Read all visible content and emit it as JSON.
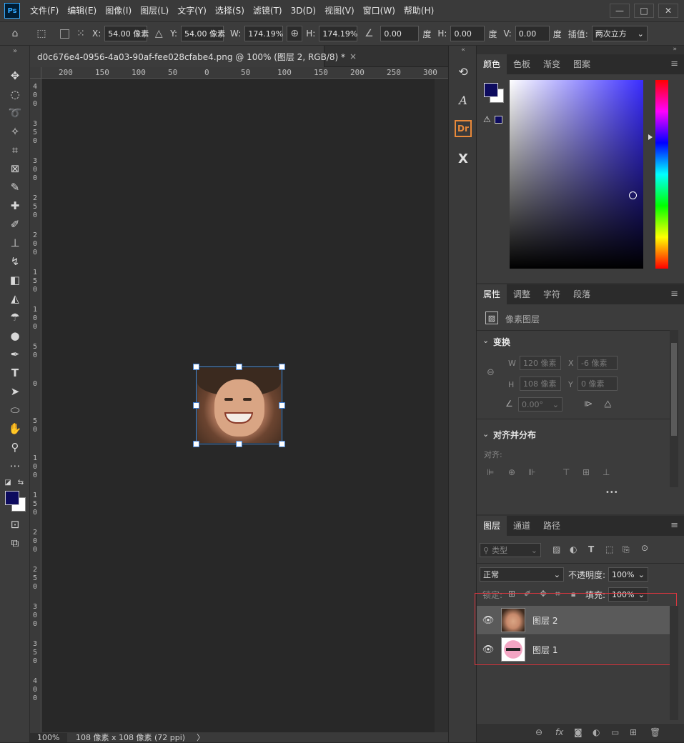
{
  "menubar": {
    "logo": "Ps",
    "items": [
      "文件(F)",
      "编辑(E)",
      "图像(I)",
      "图层(L)",
      "文字(Y)",
      "选择(S)",
      "滤镜(T)",
      "3D(D)",
      "视图(V)",
      "窗口(W)",
      "帮助(H)"
    ],
    "window_buttons": [
      "—",
      "□",
      "✕"
    ]
  },
  "options": {
    "x_label": "X:",
    "x_value": "54.00 像素",
    "y_label": "Y:",
    "y_value": "54.00 像素",
    "w_label": "W:",
    "w_value": "174.19%",
    "h_label": "H:",
    "h_value": "174.19%",
    "angle_value": "0.00",
    "angle_unit": "度",
    "hskew_label": "H:",
    "hskew_value": "0.00",
    "hskew_unit": "度",
    "vskew_label": "V:",
    "vskew_value": "0.00",
    "vskew_unit": "度",
    "interp_label": "插值:",
    "interp_value": "两次立方"
  },
  "document": {
    "tab_title": "d0c676e4-0956-4a03-90af-fee028cfabe4.png @ 100% (图层 2, RGB/8) *",
    "close": "×",
    "ruler_top": [
      "200",
      "150",
      "100",
      "50",
      "0",
      "50",
      "100",
      "150",
      "200",
      "250",
      "300"
    ],
    "ruler_left": [
      "400",
      "350",
      "300",
      "250",
      "200",
      "150",
      "100",
      "50",
      "0",
      "50",
      "100",
      "150",
      "200",
      "250",
      "300",
      "350",
      "400"
    ],
    "zoom": "100%",
    "doc_info": "108 像素 x 108 像素 (72 ppi)",
    "arrow": "〉"
  },
  "color_panel": {
    "tabs": [
      "颜色",
      "色板",
      "渐变",
      "图案"
    ],
    "foreground": "#0d0b5e",
    "background": "#ffffff",
    "hue": "#3a2dff"
  },
  "properties_panel": {
    "tabs": [
      "属性",
      "调整",
      "字符",
      "段落"
    ],
    "kind": "像素图层",
    "transform_title": "变换",
    "w_label": "W",
    "w_value": "120 像素",
    "x_label": "X",
    "x_value": "-6 像素",
    "h_label": "H",
    "h_value": "108 像素",
    "y_label": "Y",
    "y_value": "0 像素",
    "angle_value": "0.00°",
    "align_title": "对齐并分布",
    "align_label": "对齐:",
    "more": "•••"
  },
  "layers_panel": {
    "tabs": [
      "图层",
      "通道",
      "路径"
    ],
    "filter_placeholder": "类型",
    "blend_mode": "正常",
    "opacity_label": "不透明度:",
    "opacity_value": "100%",
    "lock_label": "锁定:",
    "fill_label": "填充:",
    "fill_value": "100%",
    "layers": [
      {
        "name": "图层 2",
        "selected": true
      },
      {
        "name": "图层 1",
        "selected": false
      }
    ],
    "highlight_color": "#d9363e"
  }
}
